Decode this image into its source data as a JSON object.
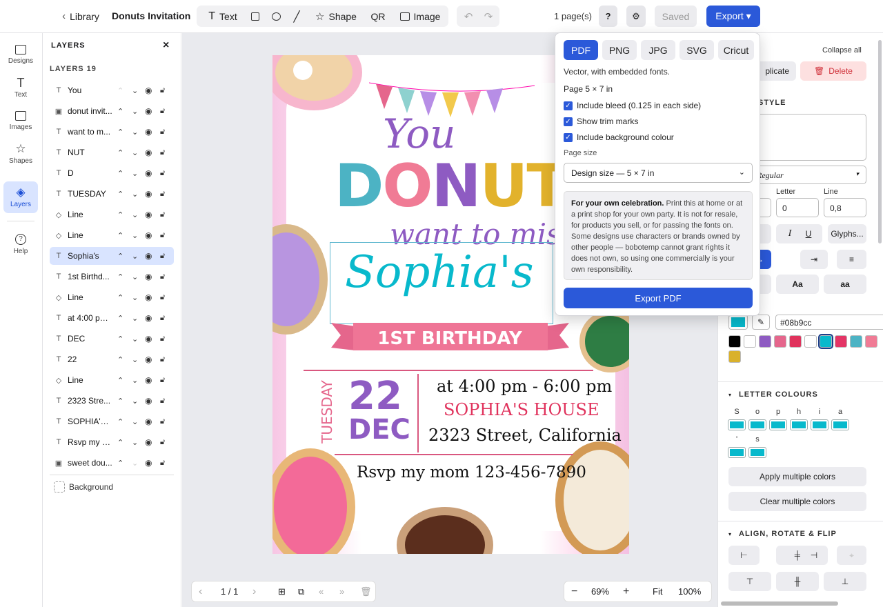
{
  "topbar": {
    "back_label": "Library",
    "doc_title": "Donuts Invitation",
    "tools": {
      "text": "Text",
      "shape": "Shape",
      "qr": "QR",
      "image": "Image"
    },
    "pages": "1 page(s)",
    "help": "?",
    "saved": "Saved",
    "export": "Export ▾"
  },
  "rail": {
    "items": [
      "Designs",
      "Text",
      "Images",
      "Shapes",
      "Layers",
      "Help"
    ]
  },
  "layers": {
    "title": "LAYERS",
    "close": "×",
    "count_label": "LAYERS 19",
    "items": [
      {
        "type": "T",
        "name": "You"
      },
      {
        "type": "▣",
        "name": "donut invit..."
      },
      {
        "type": "T",
        "name": "want to m..."
      },
      {
        "type": "T",
        "name": "NUT"
      },
      {
        "type": "T",
        "name": "D"
      },
      {
        "type": "T",
        "name": "TUESDAY"
      },
      {
        "type": "◇",
        "name": "Line"
      },
      {
        "type": "◇",
        "name": "Line"
      },
      {
        "type": "T",
        "name": "Sophia's"
      },
      {
        "type": "T",
        "name": "1st Birthd..."
      },
      {
        "type": "◇",
        "name": "Line"
      },
      {
        "type": "T",
        "name": "at 4:00 pm..."
      },
      {
        "type": "T",
        "name": "DEC"
      },
      {
        "type": "T",
        "name": "22"
      },
      {
        "type": "◇",
        "name": "Line"
      },
      {
        "type": "T",
        "name": "2323 Stre..."
      },
      {
        "type": "T",
        "name": "SOPHIA'S ..."
      },
      {
        "type": "T",
        "name": "Rsvp my m..."
      },
      {
        "type": "▣",
        "name": "sweet dou..."
      }
    ],
    "background": "Background"
  },
  "invitation": {
    "you": "You",
    "donut": "DONUT",
    "want": "want to miss",
    "name": "Sophia's",
    "birthday": "1ST BIRTHDAY",
    "weekday": "TUESDAY",
    "day": "22",
    "month": "DEC",
    "time": "at 4:00 pm - 6:00 pm",
    "house": "SOPHIA'S HOUSE",
    "street": "2323 Street, California",
    "rsvp": "Rsvp my mom 123-456-7890"
  },
  "bottombar": {
    "page": "1 / 1",
    "zoom": "69%",
    "fit": "Fit",
    "full": "100%"
  },
  "rpanel": {
    "collapse": "Collapse all",
    "duplicate": "plicate",
    "delete": "Delete",
    "style_title": "STYLE",
    "text_value": "'s",
    "font": "Regular",
    "letter_label": "Letter",
    "line_label": "Line",
    "letter_value": "0",
    "line_value": "0,8",
    "italic": "I",
    "underline": "U",
    "glyphs": "Glyphs...",
    "case_title": "Aa",
    "case_lower": "aa",
    "hex": "#08b9cc",
    "letter_colours_title": "LETTER COLOURS",
    "letters": [
      "S",
      "o",
      "p",
      "h",
      "i",
      "a",
      "'",
      "s"
    ],
    "apply_multi": "Apply multiple colors",
    "clear_multi": "Clear multiple colors",
    "align_title": "ALIGN, ROTATE & FLIP"
  },
  "palette": [
    "#000000",
    "#ffffff",
    "#8e5bc2",
    "#e5668c",
    "#e0325c",
    "#ffffff",
    "#08b9cc",
    "#e43566",
    "#4cb3c4",
    "#f07b95",
    "#d9b12c"
  ],
  "export": {
    "formats": [
      "PDF",
      "PNG",
      "JPG",
      "SVG",
      "Cricut"
    ],
    "desc": "Vector, with embedded fonts.",
    "page_info": "Page 5 × 7 in",
    "opt_bleed": "Include bleed (0.125 in each side)",
    "opt_trim": "Show trim marks",
    "opt_bg": "Include background colour",
    "page_size_label": "Page size",
    "page_size_value": "Design size — 5 × 7 in",
    "notice_bold": "For your own celebration.",
    "notice_text": "Print this at home or at a print shop for your own party. It is not for resale, for products you sell, or for passing the fonts on. Some designs use characters or brands owned by other people — bobotemp cannot grant rights it does not own, so using one commercially is your own responsibility.",
    "button": "Export PDF"
  }
}
